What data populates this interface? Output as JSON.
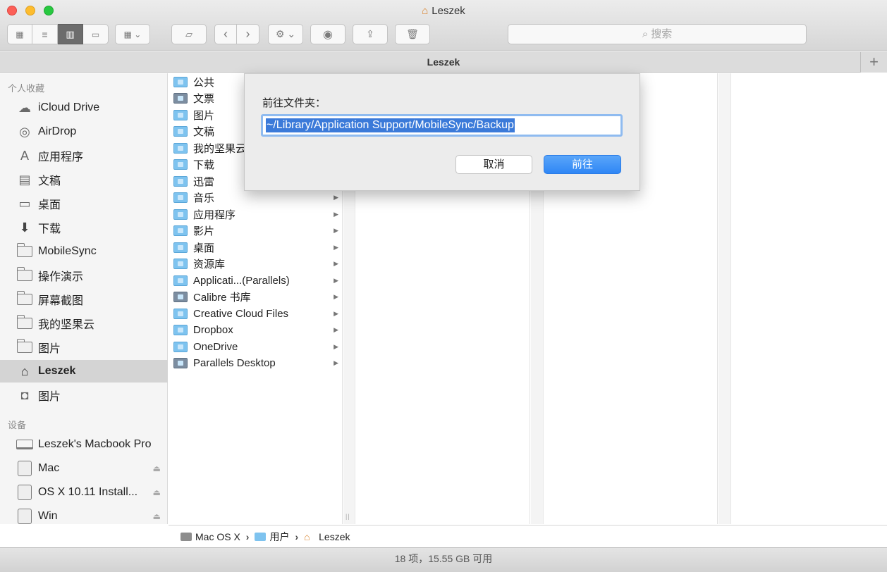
{
  "window": {
    "title": "Leszek"
  },
  "toolbar": {
    "search_placeholder": "搜索",
    "search_icon": "magnifier-icon",
    "view_buttons": [
      "icon-view",
      "list-view",
      "column-view",
      "cover-flow-view"
    ],
    "active_view": "column-view"
  },
  "path_tab": {
    "label": "Leszek",
    "add_label": "+"
  },
  "sidebar": {
    "favorites_header": "个人收藏",
    "favorites": [
      {
        "label": "iCloud Drive",
        "icon": "cloud-icon"
      },
      {
        "label": "AirDrop",
        "icon": "airdrop-icon"
      },
      {
        "label": "应用程序",
        "icon": "applications-icon"
      },
      {
        "label": "文稿",
        "icon": "documents-icon"
      },
      {
        "label": "桌面",
        "icon": "desktop-icon"
      },
      {
        "label": "下载",
        "icon": "downloads-icon"
      },
      {
        "label": "MobileSync",
        "icon": "folder-icon"
      },
      {
        "label": "操作演示",
        "icon": "folder-icon"
      },
      {
        "label": "屏幕截图",
        "icon": "folder-icon"
      },
      {
        "label": "我的坚果云",
        "icon": "folder-icon"
      },
      {
        "label": "图片",
        "icon": "folder-icon"
      },
      {
        "label": "Leszek",
        "icon": "home-icon",
        "selected": true
      },
      {
        "label": "图片",
        "icon": "camera-icon"
      }
    ],
    "devices_header": "设备",
    "devices": [
      {
        "label": "Leszek's Macbook Pro",
        "icon": "laptop-icon",
        "eject": false
      },
      {
        "label": "Mac",
        "icon": "disk-icon",
        "eject": true
      },
      {
        "label": "OS X 10.11 Install...",
        "icon": "disk-icon",
        "eject": true
      },
      {
        "label": "Win",
        "icon": "disk-icon",
        "eject": true
      }
    ]
  },
  "column1": {
    "items": [
      {
        "label": "公共",
        "arrow": false
      },
      {
        "label": "文票",
        "arrow": false,
        "dark": true
      },
      {
        "label": "图片",
        "arrow": false
      },
      {
        "label": "文稿",
        "arrow": false
      },
      {
        "label": "我的坚果云",
        "arrow": false
      },
      {
        "label": "下载",
        "arrow": false
      },
      {
        "label": "迅雷",
        "arrow": false
      },
      {
        "label": "音乐",
        "arrow": true
      },
      {
        "label": "应用程序",
        "arrow": true
      },
      {
        "label": "影片",
        "arrow": true
      },
      {
        "label": "桌面",
        "arrow": true
      },
      {
        "label": "资源库",
        "arrow": true
      },
      {
        "label": "Applicati...(Parallels)",
        "arrow": true
      },
      {
        "label": "Calibre 书库",
        "arrow": true,
        "dark": true
      },
      {
        "label": "Creative Cloud Files",
        "arrow": true
      },
      {
        "label": "Dropbox",
        "arrow": true
      },
      {
        "label": "OneDrive",
        "arrow": true
      },
      {
        "label": "Parallels Desktop",
        "arrow": true,
        "dark": true
      }
    ]
  },
  "dialog": {
    "label": "前往文件夹：",
    "input_value": "~/Library/Application Support/MobileSync/Backup",
    "cancel_label": "取消",
    "go_label": "前往"
  },
  "path_bar": {
    "segments": [
      "Mac OS X",
      "用户",
      "Leszek"
    ],
    "separator": "›"
  },
  "status": {
    "text": "18 项，15.55 GB 可用"
  },
  "colors": {
    "accent": "#2f86f5",
    "selection": "#3b7ad9",
    "folder": "#7ec3ef",
    "home": "#d9822b"
  }
}
